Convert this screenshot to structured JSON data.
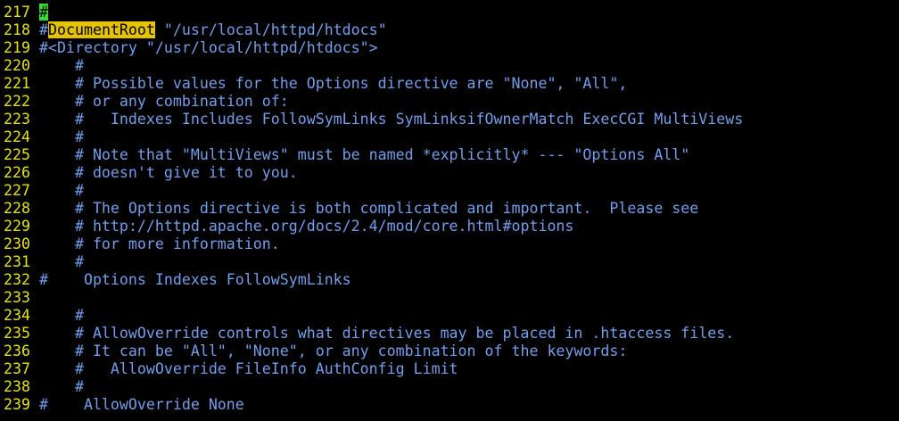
{
  "colors": {
    "background": "#000000",
    "line_number": "#e5e500",
    "comment": "#6f9fee",
    "cursor": "#33dd33",
    "search_highlight": "#e5c300"
  },
  "lines": [
    {
      "num": "217",
      "pre": "",
      "cursor": "#",
      "match": "",
      "post": ""
    },
    {
      "num": "218",
      "pre": "#",
      "cursor": "",
      "match": "DocumentRoot",
      "post": " \"/usr/local/httpd/htdocs\""
    },
    {
      "num": "219",
      "pre": "#<Directory \"/usr/local/httpd/htdocs\">",
      "cursor": "",
      "match": "",
      "post": ""
    },
    {
      "num": "220",
      "pre": "    #",
      "cursor": "",
      "match": "",
      "post": ""
    },
    {
      "num": "221",
      "pre": "    # Possible values for the Options directive are \"None\", \"All\",",
      "cursor": "",
      "match": "",
      "post": ""
    },
    {
      "num": "222",
      "pre": "    # or any combination of:",
      "cursor": "",
      "match": "",
      "post": ""
    },
    {
      "num": "223",
      "pre": "    #   Indexes Includes FollowSymLinks SymLinksifOwnerMatch ExecCGI MultiViews",
      "cursor": "",
      "match": "",
      "post": ""
    },
    {
      "num": "224",
      "pre": "    #",
      "cursor": "",
      "match": "",
      "post": ""
    },
    {
      "num": "225",
      "pre": "    # Note that \"MultiViews\" must be named *explicitly* --- \"Options All\"",
      "cursor": "",
      "match": "",
      "post": ""
    },
    {
      "num": "226",
      "pre": "    # doesn't give it to you.",
      "cursor": "",
      "match": "",
      "post": ""
    },
    {
      "num": "227",
      "pre": "    #",
      "cursor": "",
      "match": "",
      "post": ""
    },
    {
      "num": "228",
      "pre": "    # The Options directive is both complicated and important.  Please see",
      "cursor": "",
      "match": "",
      "post": ""
    },
    {
      "num": "229",
      "pre": "    # http://httpd.apache.org/docs/2.4/mod/core.html#options",
      "cursor": "",
      "match": "",
      "post": ""
    },
    {
      "num": "230",
      "pre": "    # for more information.",
      "cursor": "",
      "match": "",
      "post": ""
    },
    {
      "num": "231",
      "pre": "    #",
      "cursor": "",
      "match": "",
      "post": ""
    },
    {
      "num": "232",
      "pre": "#    Options Indexes FollowSymLinks",
      "cursor": "",
      "match": "",
      "post": ""
    },
    {
      "num": "233",
      "pre": "",
      "cursor": "",
      "match": "",
      "post": ""
    },
    {
      "num": "234",
      "pre": "    #",
      "cursor": "",
      "match": "",
      "post": ""
    },
    {
      "num": "235",
      "pre": "    # AllowOverride controls what directives may be placed in .htaccess files.",
      "cursor": "",
      "match": "",
      "post": ""
    },
    {
      "num": "236",
      "pre": "    # It can be \"All\", \"None\", or any combination of the keywords:",
      "cursor": "",
      "match": "",
      "post": ""
    },
    {
      "num": "237",
      "pre": "    #   AllowOverride FileInfo AuthConfig Limit",
      "cursor": "",
      "match": "",
      "post": ""
    },
    {
      "num": "238",
      "pre": "    #",
      "cursor": "",
      "match": "",
      "post": ""
    },
    {
      "num": "239",
      "pre": "#    AllowOverride None",
      "cursor": "",
      "match": "",
      "post": ""
    }
  ]
}
